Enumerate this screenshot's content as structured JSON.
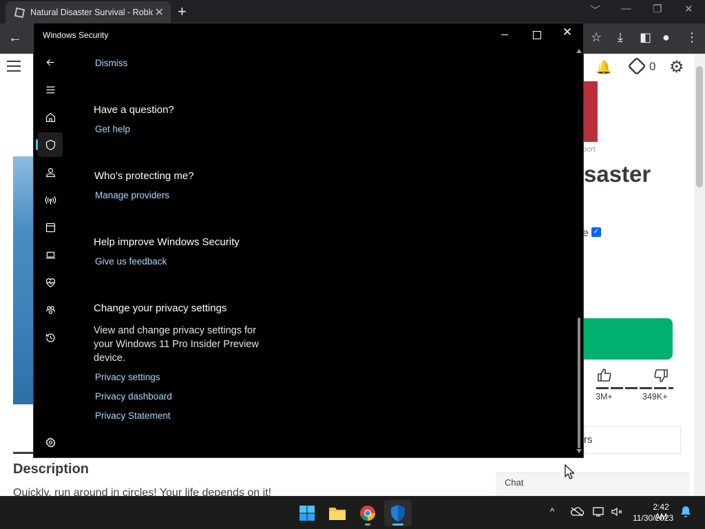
{
  "browser": {
    "tab_title": "Natural Disaster Survival - Roblox",
    "tab_close": "✕",
    "new_tab": "+",
    "window_controls": [
      "﹀",
      "—",
      "❐",
      "✕"
    ],
    "back": "←",
    "toolbar_icons": {
      "star": "☆",
      "download": "⤓",
      "sidepanel": "◧",
      "profile": "●",
      "menu": "⋮"
    }
  },
  "roblox": {
    "header_icons": {
      "bell": "🔔",
      "robux_count": "0",
      "settings": "⚙"
    },
    "report_text": "port",
    "game_title_tail": "saster",
    "creator_tail": "e",
    "verified": "✓",
    "thumbs_up": "👍",
    "thumbs_down": "👎",
    "upvotes": "3M+",
    "downvotes": "349K+",
    "servers_tail": "rs",
    "description_title": "Description",
    "description_text": "Quickly, run around in circles! Your life depends on it!",
    "chat_label": "Chat"
  },
  "window": {
    "title": "Windows Security",
    "close": "✕"
  },
  "content": {
    "dismiss": "Dismiss",
    "sections": {
      "question": {
        "heading": "Have a question?",
        "link": "Get help"
      },
      "protecting": {
        "heading": "Who's protecting me?",
        "link": "Manage providers"
      },
      "improve": {
        "heading": "Help improve Windows Security",
        "link": "Give us feedback"
      },
      "privacy": {
        "heading": "Change your privacy settings",
        "description": "View and change privacy settings for your Windows 11 Pro Insider Preview device.",
        "links": [
          "Privacy settings",
          "Privacy dashboard",
          "Privacy Statement"
        ]
      }
    }
  },
  "nav": {
    "back_icon": "back-arrow-icon",
    "selected_item": "virus-threat-protection",
    "accent_color": "#4cc2ff"
  },
  "taskbar": {
    "tray_chevron": "^",
    "time": "2:42 AM",
    "date": "11/30/2023",
    "notification": "🔔"
  },
  "colors": {
    "link": "#a6d8ff",
    "window_bg": "#000000",
    "play_button": "#00b06f"
  }
}
